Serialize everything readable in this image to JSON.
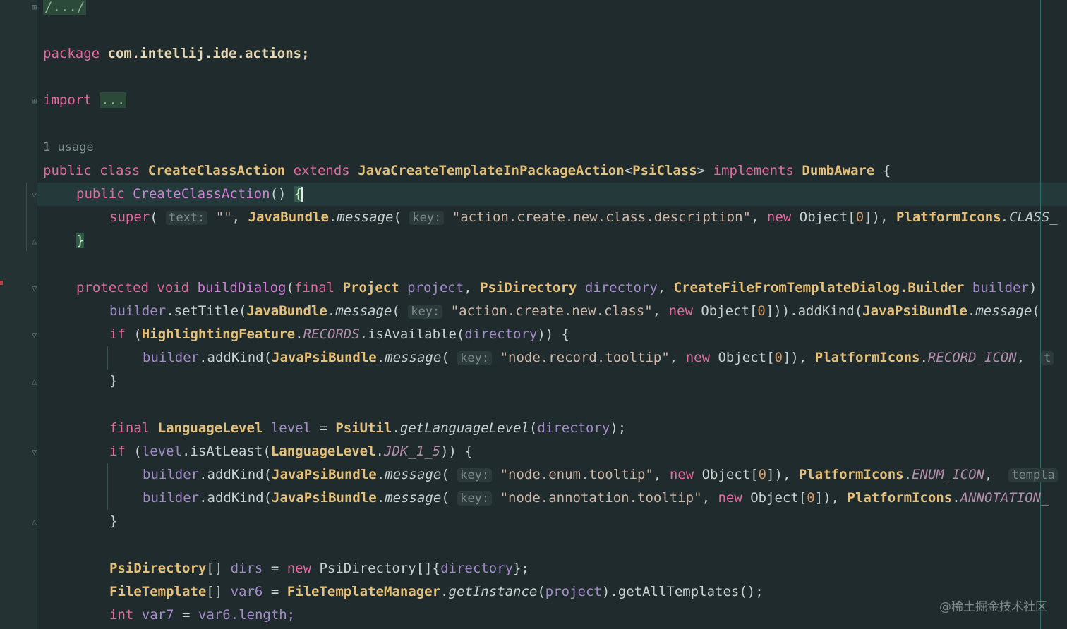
{
  "code": {
    "collapsed_header": "/.../",
    "package_kw": "package",
    "package_name": "com.intellij.ide.actions;",
    "import_kw": "import",
    "import_fold": "...",
    "usage_hint": "1 usage",
    "class_decl": {
      "kw1": "public",
      "kw2": "class",
      "name": "CreateClassAction",
      "kw3": "extends",
      "super": "JavaCreateTemplateInPackageAction",
      "generic": "PsiClass",
      "kw4": "implements",
      "iface": "DumbAware",
      "brace": " {"
    },
    "ctor": {
      "kw": "public",
      "name": "CreateClassAction",
      "parens": "() ",
      "brace": "{"
    },
    "super_call": {
      "kw": "super",
      "open": "(",
      "hint_text": "text:",
      "empty": "\"\"",
      "comma": ", ",
      "bundle": "JavaBundle",
      "msg": "message",
      "hint_key": "key:",
      "str": "\"action.create.new.class.description\"",
      "rest1": ", ",
      "new": "new",
      "obj": " Object[",
      "zero": "0",
      "rest2": "]), ",
      "icons": "PlatformIcons",
      "icon": ".CLASS_"
    },
    "close_ctor": "}",
    "build_dialog": {
      "kw1": "protected",
      "kw2": "void",
      "name": "buildDialog",
      "open": "(",
      "final": "final",
      "t1": "Project",
      "p1": "project",
      "t2": "PsiDirectory",
      "p2": "directory",
      "t3": "CreateFileFromTemplateDialog.Builder",
      "p3": "builder",
      "close": ")"
    },
    "set_title": {
      "obj": "builder",
      "m": ".setTitle(",
      "bundle": "JavaBundle",
      "msg": "message",
      "hint_key": "key:",
      "str": "\"action.create.new.class\"",
      "new": "new",
      "zero": "0",
      "rest": "])).addKind(",
      "bundle2": "JavaPsiBundle",
      "msg2": "message"
    },
    "if_records": {
      "kw": "if",
      "feat": "HighlightingFeature",
      "rec": "RECORDS",
      "m": ".isAvailable(",
      "p": "directory",
      "end": ")) {"
    },
    "add_record": {
      "obj": "builder",
      "m": ".addKind(",
      "bundle": "JavaPsiBundle",
      "msg": "message",
      "hint_key": "key:",
      "str": "\"node.record.tooltip\"",
      "new": "new",
      "zero": "0",
      "icons": "PlatformIcons",
      "icon": "RECORD_ICON",
      "tail_hint": "t"
    },
    "close_if": "}",
    "level_decl": {
      "kw": "final",
      "t": "LanguageLevel",
      "v": "level",
      "eq": " = ",
      "util": "PsiUtil",
      "m": "getLanguageLevel",
      "p": "directory",
      "end": ");"
    },
    "if_level": {
      "kw": "if",
      "v": "level",
      "m": ".isAtLeast(",
      "t": "LanguageLevel",
      "c": "JDK_1_5",
      "end": ")) {"
    },
    "add_enum": {
      "obj": "builder",
      "m": ".addKind(",
      "bundle": "JavaPsiBundle",
      "msg": "message",
      "hint_key": "key:",
      "str": "\"node.enum.tooltip\"",
      "new": "new",
      "zero": "0",
      "icons": "PlatformIcons",
      "icon": "ENUM_ICON",
      "tail_hint": "templa"
    },
    "add_annot": {
      "obj": "builder",
      "m": ".addKind(",
      "bundle": "JavaPsiBundle",
      "msg": "message",
      "hint_key": "key:",
      "str": "\"node.annotation.tooltip\"",
      "new": "new",
      "zero": "0",
      "icons": "PlatformIcons",
      "icon": "ANNOTATION_"
    },
    "close_if2": "}",
    "dirs_decl": {
      "t": "PsiDirectory",
      "arr": "[] ",
      "v": "dirs",
      "eq": " = ",
      "new": "new",
      "t2": " PsiDirectory[]{",
      "p": "directory",
      "end": "};"
    },
    "templ_decl": {
      "t": "FileTemplate",
      "arr": "[] ",
      "v": "var6",
      "eq": " = ",
      "mgr": "FileTemplateManager",
      "m": "getInstance",
      "p": "project",
      "end": ").getAllTemplates();"
    },
    "int_decl": {
      "kw": "int",
      "v": "var7",
      "eq": " = ",
      "rhs": "var6.length;"
    }
  },
  "watermark": "@稀土掘金技术社区"
}
